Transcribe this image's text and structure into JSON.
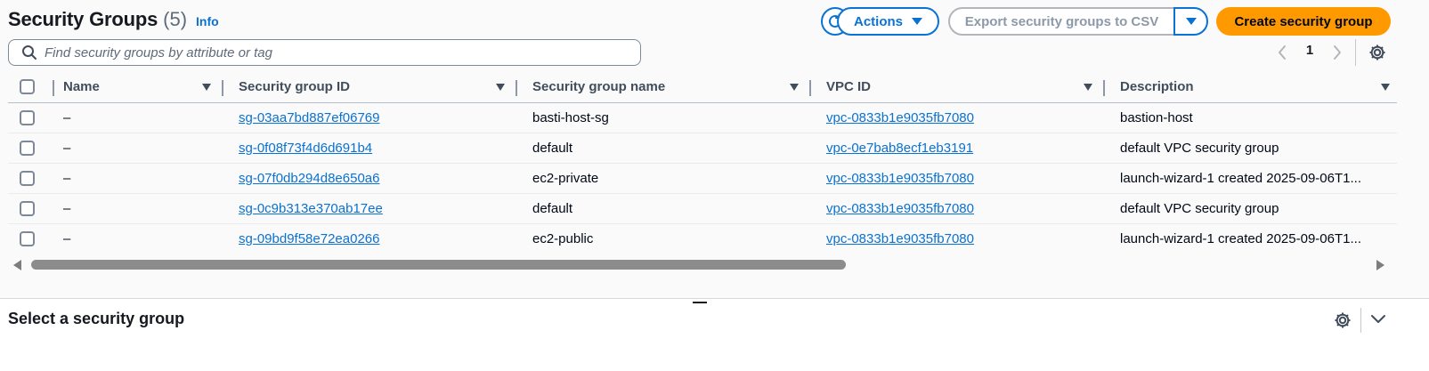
{
  "header": {
    "title": "Security Groups",
    "count": "(5)",
    "info_label": "Info"
  },
  "toolbar": {
    "actions_label": "Actions",
    "export_label": "Export security groups to CSV",
    "create_label": "Create security group"
  },
  "search": {
    "placeholder": "Find security groups by attribute or tag",
    "value": ""
  },
  "pagination": {
    "current_page": "1"
  },
  "table": {
    "columns": [
      "Name",
      "Security group ID",
      "Security group name",
      "VPC ID",
      "Description"
    ],
    "rows": [
      {
        "name": "–",
        "id": "sg-03aa7bd887ef06769",
        "group_name": "basti-host-sg",
        "vpc": "vpc-0833b1e9035fb7080",
        "description": "bastion-host"
      },
      {
        "name": "–",
        "id": "sg-0f08f73f4d6d691b4",
        "group_name": "default",
        "vpc": "vpc-0e7bab8ecf1eb3191",
        "description": "default VPC security group"
      },
      {
        "name": "–",
        "id": "sg-07f0db294d8e650a6",
        "group_name": "ec2-private",
        "vpc": "vpc-0833b1e9035fb7080",
        "description": "launch-wizard-1 created 2025-09-06T1..."
      },
      {
        "name": "–",
        "id": "sg-0c9b313e370ab17ee",
        "group_name": "default",
        "vpc": "vpc-0833b1e9035fb7080",
        "description": "default VPC security group"
      },
      {
        "name": "–",
        "id": "sg-09bd9f58e72ea0266",
        "group_name": "ec2-public",
        "vpc": "vpc-0833b1e9035fb7080",
        "description": "launch-wizard-1 created 2025-09-06T1..."
      }
    ]
  },
  "details": {
    "title": "Select a security group"
  },
  "colors": {
    "link": "#0972d3",
    "primary": "#ff9900",
    "text": "#000716"
  }
}
